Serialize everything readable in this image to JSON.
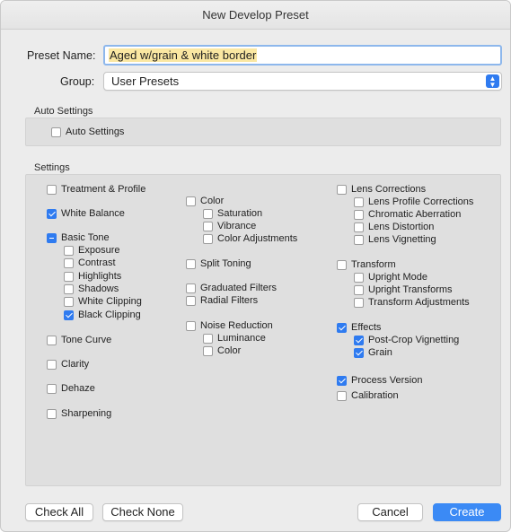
{
  "title": "New Develop Preset",
  "preset_name": {
    "label": "Preset Name:",
    "value": "Aged w/grain & white border"
  },
  "group": {
    "label": "Group:",
    "value": "User Presets"
  },
  "auto_settings": {
    "section": "Auto Settings",
    "checkbox_label": "Auto Settings",
    "checked": false
  },
  "settings": {
    "section": "Settings",
    "col1": [
      {
        "label": "Treatment & Profile",
        "state": "off"
      },
      {
        "label": "White Balance",
        "state": "on"
      },
      {
        "label": "Basic Tone",
        "state": "mixed"
      },
      {
        "label": "Exposure",
        "state": "off"
      },
      {
        "label": "Contrast",
        "state": "off"
      },
      {
        "label": "Highlights",
        "state": "off"
      },
      {
        "label": "Shadows",
        "state": "off"
      },
      {
        "label": "White Clipping",
        "state": "off"
      },
      {
        "label": "Black Clipping",
        "state": "on"
      },
      {
        "label": "Tone Curve",
        "state": "off"
      },
      {
        "label": "Clarity",
        "state": "off"
      },
      {
        "label": "Dehaze",
        "state": "off"
      },
      {
        "label": "Sharpening",
        "state": "off"
      }
    ],
    "col2": [
      {
        "label": "Color",
        "state": "off"
      },
      {
        "label": "Saturation",
        "state": "off"
      },
      {
        "label": "Vibrance",
        "state": "off"
      },
      {
        "label": "Color Adjustments",
        "state": "off"
      },
      {
        "label": "Split Toning",
        "state": "off"
      },
      {
        "label": "Graduated Filters",
        "state": "off"
      },
      {
        "label": "Radial Filters",
        "state": "off"
      },
      {
        "label": "Noise Reduction",
        "state": "off"
      },
      {
        "label": "Luminance",
        "state": "off"
      },
      {
        "label": "Color",
        "state": "off"
      }
    ],
    "col3": [
      {
        "label": "Lens Corrections",
        "state": "off"
      },
      {
        "label": "Lens Profile Corrections",
        "state": "off"
      },
      {
        "label": "Chromatic Aberration",
        "state": "off"
      },
      {
        "label": "Lens Distortion",
        "state": "off"
      },
      {
        "label": "Lens Vignetting",
        "state": "off"
      },
      {
        "label": "Transform",
        "state": "off"
      },
      {
        "label": "Upright Mode",
        "state": "off"
      },
      {
        "label": "Upright Transforms",
        "state": "off"
      },
      {
        "label": "Transform Adjustments",
        "state": "off"
      },
      {
        "label": "Effects",
        "state": "on"
      },
      {
        "label": "Post-Crop Vignetting",
        "state": "on"
      },
      {
        "label": "Grain",
        "state": "on"
      },
      {
        "label": "Process Version",
        "state": "on"
      },
      {
        "label": "Calibration",
        "state": "off"
      }
    ]
  },
  "buttons": {
    "check_all": "Check All",
    "check_none": "Check None",
    "cancel": "Cancel",
    "create": "Create"
  },
  "colors": {
    "accent": "#2f7bf0",
    "selection": "#fae7a2"
  }
}
